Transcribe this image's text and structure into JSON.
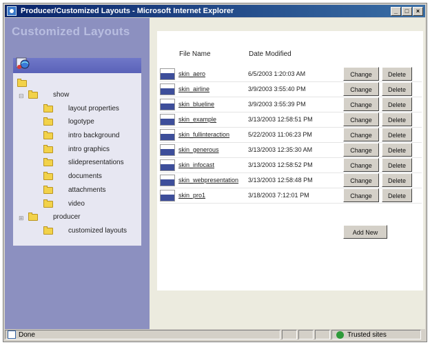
{
  "window": {
    "title": "Producer/Customized Layouts - Microsoft Internet Explorer"
  },
  "sidebar": {
    "title": "Customized Layouts",
    "tree": [
      {
        "label": "show"
      },
      {
        "label": "layout properties"
      },
      {
        "label": "logotype"
      },
      {
        "label": "intro background"
      },
      {
        "label": "intro graphics"
      },
      {
        "label": "slidepresentations"
      },
      {
        "label": "documents"
      },
      {
        "label": "attachments"
      },
      {
        "label": "video"
      },
      {
        "label": "producer"
      },
      {
        "label": "customized layouts"
      }
    ]
  },
  "table": {
    "headers": {
      "file_name": "File Name",
      "date_modified": "Date Modified"
    },
    "rows": [
      {
        "name": "skin_aero",
        "date": "6/5/2003 1:20:03 AM"
      },
      {
        "name": "skin_airline",
        "date": "3/9/2003 3:55:40 PM"
      },
      {
        "name": "skin_blueline",
        "date": "3/9/2003 3:55:39 PM"
      },
      {
        "name": "skin_example",
        "date": "3/13/2003 12:58:51 PM"
      },
      {
        "name": "skin_fullinteraction",
        "date": "5/22/2003 11:06:23 PM"
      },
      {
        "name": "skin_generous",
        "date": "3/13/2003 12:35:30 AM"
      },
      {
        "name": "skin_infocast",
        "date": "3/13/2003 12:58:52 PM"
      },
      {
        "name": "skin_webpresentation",
        "date": "3/13/2003 12:58:48 PM"
      },
      {
        "name": "skin_pro1",
        "date": "3/18/2003 7:12:01 PM"
      }
    ],
    "change_label": "Change",
    "delete_label": "Delete",
    "add_new_label": "Add New"
  },
  "status": {
    "text": "Done",
    "zone": "Trusted sites"
  }
}
